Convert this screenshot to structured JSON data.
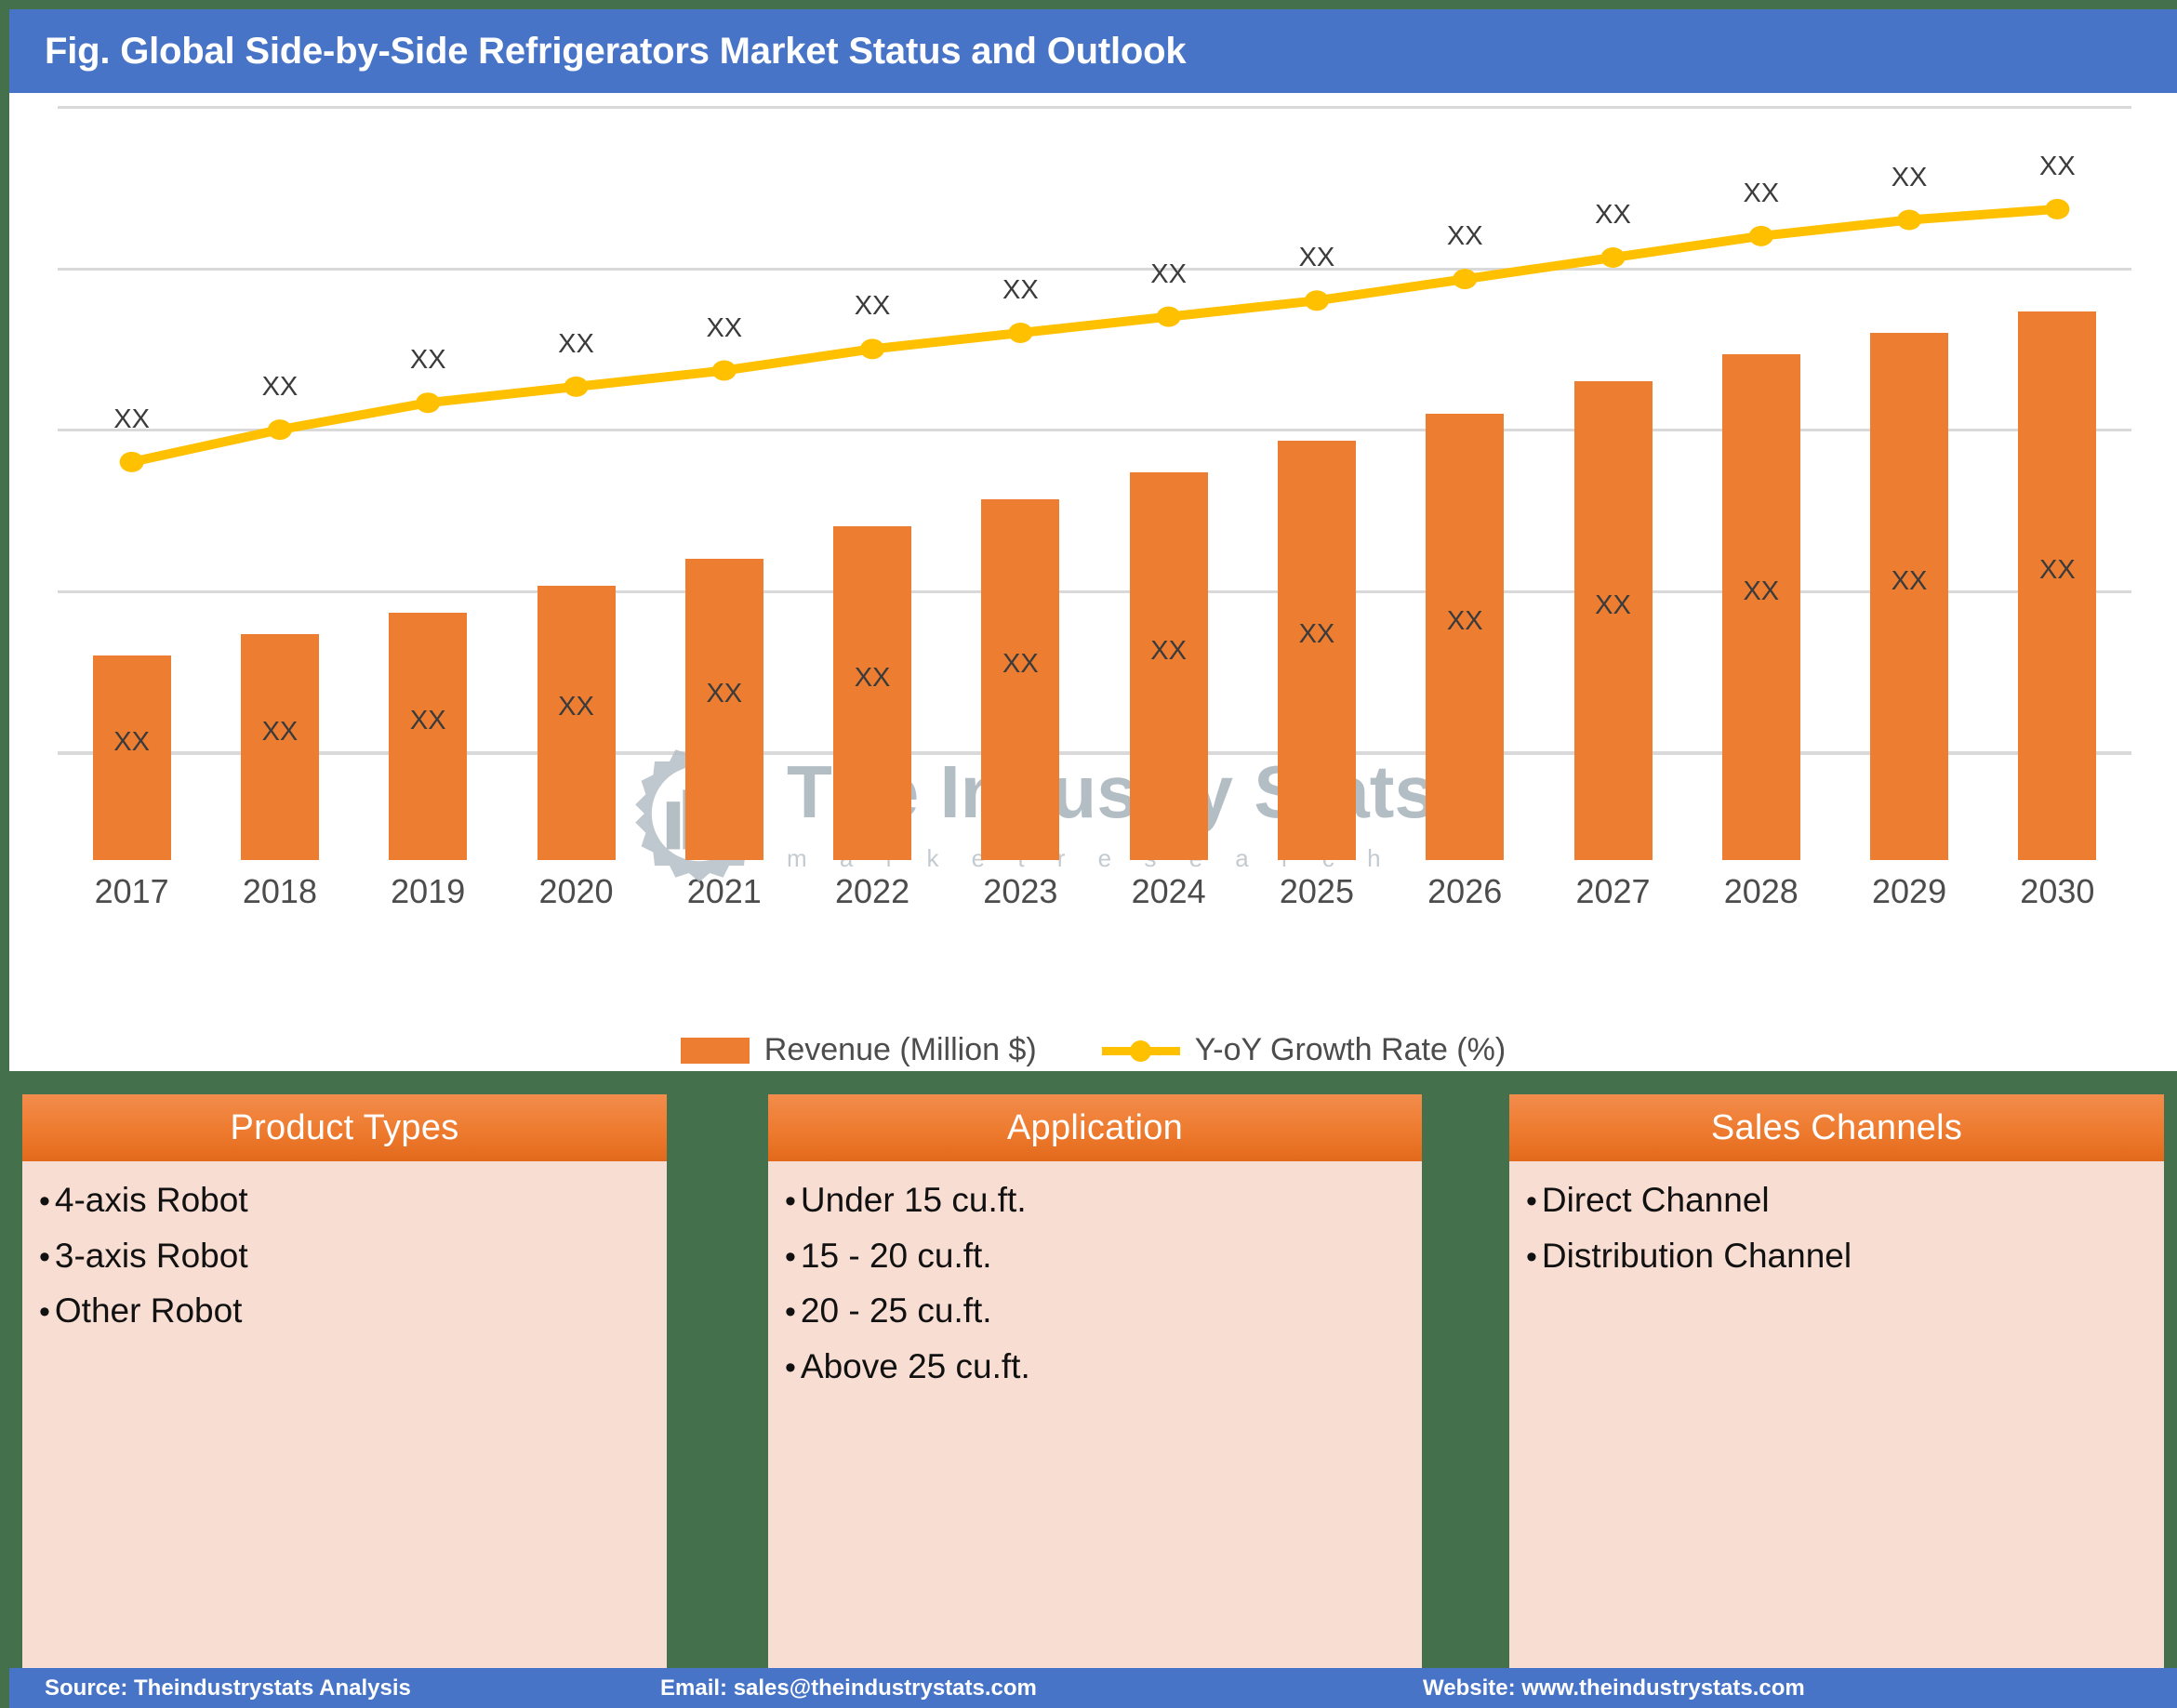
{
  "header": {
    "title": "Fig. Global Side-by-Side Refrigerators Market Status and Outlook",
    "bg_color": "#4874c8"
  },
  "chart_data": {
    "type": "bar",
    "title": "Fig. Global Side-by-Side Refrigerators Market Status and Outlook",
    "xlabel": "",
    "ylabel": "",
    "grid": true,
    "legend_position": "bottom",
    "categories": [
      "2017",
      "2018",
      "2019",
      "2020",
      "2021",
      "2022",
      "2023",
      "2024",
      "2025",
      "2026",
      "2027",
      "2028",
      "2029",
      "2030"
    ],
    "series": [
      {
        "name": "Revenue (Million $)",
        "type": "bar",
        "color": "#ed7d31",
        "values": [
          38,
          42,
          46,
          51,
          56,
          62,
          67,
          72,
          78,
          83,
          89,
          94,
          98,
          102
        ],
        "data_labels": [
          "XX",
          "XX",
          "XX",
          "XX",
          "XX",
          "XX",
          "XX",
          "XX",
          "XX",
          "XX",
          "XX",
          "XX",
          "XX",
          "XX"
        ]
      },
      {
        "name": "Y-oY Growth Rate (%)",
        "type": "line",
        "color": "#ffc000",
        "values": [
          74,
          80,
          85,
          88,
          91,
          95,
          98,
          101,
          104,
          108,
          112,
          116,
          119,
          121
        ],
        "data_labels": [
          "XX",
          "XX",
          "XX",
          "XX",
          "XX",
          "XX",
          "XX",
          "XX",
          "XX",
          "XX",
          "XX",
          "XX",
          "XX",
          "XX"
        ]
      }
    ],
    "ylim": [
      0,
      140
    ],
    "gridline_values": [
      20,
      50,
      80,
      110,
      140
    ]
  },
  "legend": {
    "items": [
      {
        "label": "Revenue (Million $)",
        "marker": "bar-swatch",
        "color": "#ed7d31"
      },
      {
        "label": "Y-oY Growth Rate (%)",
        "marker": "line-dot",
        "color": "#ffc000"
      }
    ]
  },
  "watermark": {
    "main": "The Industry Stats",
    "sub": "m a r k e t   r e s e a r c h"
  },
  "panels": [
    {
      "title": "Product Types",
      "items": [
        "4-axis Robot",
        "3-axis Robot",
        "Other Robot"
      ]
    },
    {
      "title": "Application",
      "items": [
        "Under 15 cu.ft.",
        "15 - 20 cu.ft.",
        "20 - 25 cu.ft.",
        "Above 25 cu.ft."
      ]
    },
    {
      "title": "Sales Channels",
      "items": [
        "Direct Channel",
        "Distribution Channel"
      ]
    }
  ],
  "footer": {
    "source": "Source: Theindustrystats Analysis",
    "email": "Email: sales@theindustrystats.com",
    "website": "Website: www.theindustrystats.com",
    "bg_color": "#4874c8"
  },
  "colors": {
    "frame_green": "#44714c",
    "bar_orange": "#ed7d31",
    "line_yellow": "#ffc000",
    "panel_body": "#f8ddd2",
    "panel_head": "#ee7b2f",
    "header_blue": "#4874c8"
  }
}
